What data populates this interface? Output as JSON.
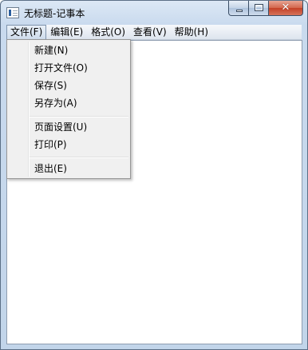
{
  "window": {
    "title": "无标题-记事本"
  },
  "caption": {
    "close_label": "✕"
  },
  "menubar": {
    "items": [
      "文件(F)",
      "编辑(E)",
      "格式(O)",
      "查看(V)",
      "帮助(H)"
    ]
  },
  "file_menu": {
    "items": [
      "新建(N)",
      "打开文件(O)",
      "保存(S)",
      "另存为(A)",
      "页面设置(U)",
      "打印(P)",
      "退出(E)"
    ]
  },
  "editor": {
    "content": ""
  }
}
